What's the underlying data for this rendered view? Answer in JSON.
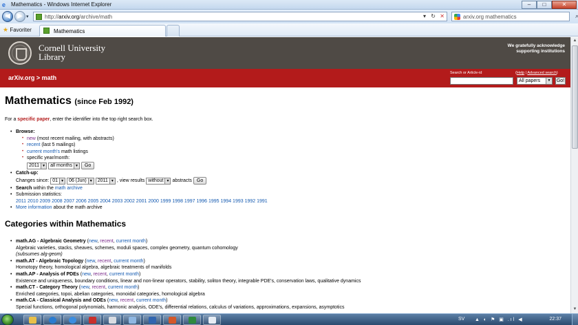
{
  "window": {
    "title": "Mathematics - Windows Internet Explorer",
    "controls": {
      "minimize": "–",
      "maximize": "□",
      "close": "✕"
    }
  },
  "address_bar": {
    "url_prefix": "http://",
    "url_domain": "arxiv.org",
    "url_path": "/archive/math",
    "refresh": "↻",
    "stop": "✕",
    "search_text": "arxiv.org mathematics",
    "search_icon": "⌕"
  },
  "favorites_bar": {
    "favorites_label": "Favoriter",
    "active_tab": "Mathematics"
  },
  "header": {
    "institution_line1": "Cornell University",
    "institution_line2": "Library",
    "acknowledge_line1": "We gratefully acknowledge",
    "acknowledge_line2": "supporting institutions"
  },
  "redbar": {
    "breadcrumb_site": "arXiv.org",
    "breadcrumb_sep": " > ",
    "breadcrumb_section": "math",
    "search_label": "Search or Article-id",
    "help_link": "Help",
    "advanced_link": "Advanced search",
    "search_scope": "All papers",
    "go_label": "Go!"
  },
  "main": {
    "title": "Mathematics",
    "title_since": "(since Feb 1992)",
    "intro_prefix": "For a ",
    "intro_link": "specific paper",
    "intro_suffix": ", enter the identifier into the top right search box.",
    "browse_label": "Browse:",
    "browse_new_link": "new",
    "browse_new_note": " (most recent mailing, with abstracts)",
    "browse_recent_link": "recent",
    "browse_recent_note": " (last 5 mailings)",
    "browse_current_link": "current month's",
    "browse_current_note": " math listings",
    "browse_specific": "specific year/month:",
    "year_select": "2011",
    "month_select": "all months",
    "go_button": "Go",
    "catchup_label": "Catch-up:",
    "changes_since": "Changes since:",
    "day_select": "01",
    "month2_select": "06 (Jun)",
    "year2_select": "2011",
    "view_results": ", view results",
    "abstracts_select": "without",
    "abstracts_label": "abstracts",
    "catchup_go": "Go",
    "search_label": "Search",
    "search_within": " within the ",
    "search_link": "math archive",
    "stats_label": "Submission statistics:",
    "stats_years": [
      "2011",
      "2010",
      "2009",
      "2008",
      "2007",
      "2006",
      "2005",
      "2004",
      "2003",
      "2002",
      "2001",
      "2000",
      "1999",
      "1998",
      "1997",
      "1996",
      "1995",
      "1994",
      "1993",
      "1992",
      "1991"
    ],
    "more_info_link": "More information",
    "more_info_note": " about the math archive"
  },
  "categories": {
    "heading": "Categories within Mathematics",
    "items": [
      {
        "code": "math.AG - Algebraic Geometry",
        "new": "new",
        "recent": "recent",
        "current": "current month",
        "desc": "Algebraic varieties, stacks, sheaves, schemes, moduli spaces, complex geometry, quantum cohomology",
        "note": "(subsumes alg-geom)"
      },
      {
        "code": "math.AT - Algebraic Topology",
        "new": "new",
        "recent": "recent",
        "current": "current month",
        "desc": "Homotopy theory, homological algebra, algebraic treatments of manifolds",
        "note": ""
      },
      {
        "code": "math.AP - Analysis of PDEs",
        "new": "new",
        "recent": "recent",
        "current": "current month",
        "desc": "Existence and uniqueness, boundary conditions, linear and non-linear operators, stability, soliton theory, integrable PDE's, conservation laws, qualitative dynamics",
        "note": ""
      },
      {
        "code": "math.CT - Category Theory",
        "new": "new",
        "recent": "recent",
        "current": "current month",
        "desc": "Enriched categories, topoi, abelian categories, monoidal categories, homological algebra",
        "note": ""
      },
      {
        "code": "math.CA - Classical Analysis and ODEs",
        "new": "new",
        "recent": "recent",
        "current": "current month",
        "desc": "Special functions, orthogonal polynomials, harmonic analysis, ODE's, differential relations, calculus of variations, approximations, expansions, asymptotics",
        "note": ""
      }
    ]
  },
  "taskbar": {
    "language": "SV",
    "clock": "22:37",
    "tray_icons": "▲ ◐ ⚑ ▣ .ıl ◀"
  }
}
